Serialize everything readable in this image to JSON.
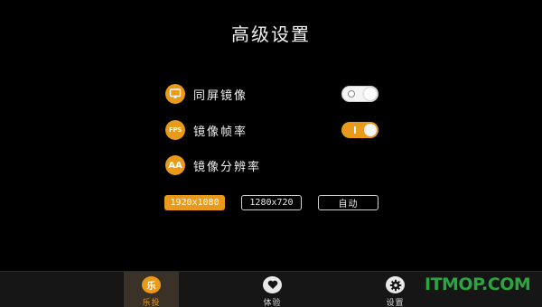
{
  "header": {
    "title": "高级设置"
  },
  "settings": {
    "mirror": {
      "label": "同屏镜像",
      "icon": "screen-mirror-icon",
      "enabled": false
    },
    "fps": {
      "label": "镜像帧率",
      "icon_text": "FPS",
      "enabled": true
    },
    "resolution": {
      "label": "镜像分辨率",
      "icon_text": "AA",
      "options": [
        "1920x1080",
        "1280x720",
        "自动"
      ],
      "selected": "1920x1080"
    }
  },
  "tabbar": {
    "tabs": [
      {
        "label": "乐投",
        "icon_text": "乐",
        "active": true
      },
      {
        "label": "体验",
        "icon": "heart-icon",
        "active": false
      },
      {
        "label": "设置",
        "icon": "gear-icon",
        "active": false
      }
    ]
  },
  "watermark": {
    "text": "ITMOP.COM"
  },
  "colors": {
    "accent": "#e99a1a",
    "background": "#000000",
    "tabbar": "#161616"
  }
}
